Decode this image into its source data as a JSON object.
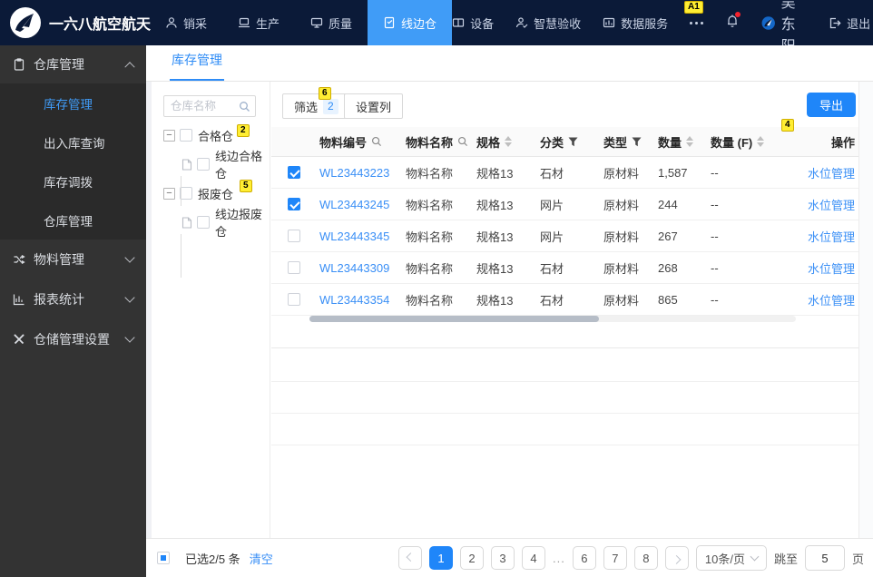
{
  "topbar": {
    "brand": "一六八航空航天",
    "nav": [
      {
        "label": "销采",
        "active": false
      },
      {
        "label": "生产",
        "active": false
      },
      {
        "label": "质量",
        "active": false
      },
      {
        "label": "线边仓",
        "active": true
      },
      {
        "label": "设备",
        "active": false
      },
      {
        "label": "智慧验收",
        "active": false
      },
      {
        "label": "数据服务",
        "active": false
      }
    ],
    "user": "吴东阳",
    "logout_label": "退出"
  },
  "sidebar": {
    "groups": [
      {
        "label": "仓库管理",
        "expanded": true,
        "children": [
          {
            "label": "库存管理",
            "active": true
          },
          {
            "label": "出入库查询",
            "active": false
          },
          {
            "label": "库存调拨",
            "active": false
          },
          {
            "label": "仓库管理",
            "active": false
          }
        ]
      },
      {
        "label": "物料管理",
        "expanded": false
      },
      {
        "label": "报表统计",
        "expanded": false
      },
      {
        "label": "仓储管理设置",
        "expanded": false
      }
    ]
  },
  "tabs": [
    {
      "label": "库存管理",
      "active": true
    }
  ],
  "tree": {
    "search_placeholder": "仓库名称",
    "nodes": [
      {
        "label": "合格仓",
        "checked": false,
        "children": [
          {
            "label": "线边合格仓",
            "checked": false
          }
        ]
      },
      {
        "label": "报废仓",
        "checked": false,
        "children": [
          {
            "label": "线边报废仓",
            "checked": false
          }
        ]
      }
    ]
  },
  "toolbar": {
    "filter_label": "筛选",
    "filter_count": "2",
    "columns_label": "设置列",
    "export_label": "导出"
  },
  "table": {
    "headers": {
      "code": "物料编号",
      "name": "物料名称",
      "spec": "规格",
      "category": "分类",
      "type": "类型",
      "qty": "数量",
      "qtyf": "数量 (F)",
      "actions": "操作"
    },
    "rows": [
      {
        "checked": true,
        "code": "WL23443223",
        "name": "物料名称",
        "spec": "规格13",
        "category": "石材",
        "type": "原材料",
        "qty": "1,587",
        "qtyf": "--",
        "action": "水位管理"
      },
      {
        "checked": true,
        "code": "WL23443245",
        "name": "物料名称",
        "spec": "规格13",
        "category": "网片",
        "type": "原材料",
        "qty": "244",
        "qtyf": "--",
        "action": "水位管理"
      },
      {
        "checked": false,
        "code": "WL23443345",
        "name": "物料名称",
        "spec": "规格13",
        "category": "网片",
        "type": "原材料",
        "qty": "267",
        "qtyf": "--",
        "action": "水位管理"
      },
      {
        "checked": false,
        "code": "WL23443309",
        "name": "物料名称",
        "spec": "规格13",
        "category": "石材",
        "type": "原材料",
        "qty": "268",
        "qtyf": "--",
        "action": "水位管理"
      },
      {
        "checked": false,
        "code": "WL23443354",
        "name": "物料名称",
        "spec": "规格13",
        "category": "石材",
        "type": "原材料",
        "qty": "865",
        "qtyf": "--",
        "action": "水位管理"
      }
    ]
  },
  "footer": {
    "indeterminate": true,
    "selected_text": "已选2/5 条",
    "clear_label": "清空",
    "pages": [
      {
        "label": "1",
        "active": true
      },
      {
        "label": "2",
        "active": false
      },
      {
        "label": "3",
        "active": false
      },
      {
        "label": "4",
        "active": false
      },
      {
        "label": "6",
        "active": false
      },
      {
        "label": "7",
        "active": false
      },
      {
        "label": "8",
        "active": false
      }
    ],
    "ellipsis": "...",
    "page_size": "10条/页",
    "jump_label": "跳至",
    "jump_value": "5",
    "jump_suffix": "页"
  },
  "annotations": {
    "a1": "A1",
    "n2": "2",
    "n4": "4",
    "n5": "5",
    "n6": "6"
  }
}
